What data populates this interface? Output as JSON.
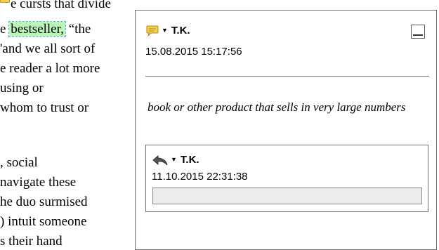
{
  "document": {
    "lines": [
      {
        "text": "e cursts that divide"
      },
      {
        "before": "e ",
        "highlight": "bestseller,",
        "after": " “the"
      },
      {
        "text": "'and we all sort of"
      },
      {
        "text": "e reader a lot more"
      },
      {
        "text": "using or"
      },
      {
        "text": "whom to trust or"
      },
      {
        "text": ""
      },
      {
        "text": ""
      },
      {
        "text": ", social"
      },
      {
        "text": "navigate these"
      },
      {
        "text": "he duo surmised"
      },
      {
        "text": ") intuit someone"
      },
      {
        "text": "s their hand"
      }
    ]
  },
  "comment": {
    "author": "T.K.",
    "timestamp": "15.08.2015 15:17:56",
    "text": "book or other product that sells in very large numbers",
    "icon": "speech-bubble-icon"
  },
  "reply": {
    "author": "T.K.",
    "timestamp": "11.10.2015 22:31:38",
    "input_value": "",
    "icon": "reply-arrow-icon"
  },
  "colors": {
    "highlight": "#b9f6b8",
    "bubble": "#f5d04d"
  }
}
